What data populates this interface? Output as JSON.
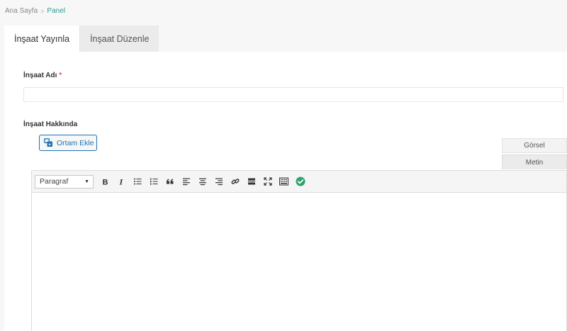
{
  "breadcrumb": {
    "home": "Ana Sayfa",
    "separator": ">",
    "current": "Panel"
  },
  "tabs": [
    {
      "label": "İnşaat Yayınla",
      "active": true
    },
    {
      "label": "İnşaat Düzenle",
      "active": false
    }
  ],
  "form": {
    "name_label": "İnşaat Adı",
    "required_mark": "*",
    "name_value": "",
    "about_label": "İnşaat Hakkında",
    "media_button": "Ortam Ekle"
  },
  "editor": {
    "mode_visual": "Görsel",
    "mode_text": "Metin",
    "format_select": "Paragraf",
    "toolbar_icons": [
      "bold-icon",
      "italic-icon",
      "bullet-list-icon",
      "numbered-list-icon",
      "blockquote-icon",
      "align-left-icon",
      "align-center-icon",
      "align-right-icon",
      "link-icon",
      "read-more-icon",
      "fullscreen-icon",
      "toolbar-toggle-icon",
      "check-circle-icon"
    ],
    "content": ""
  },
  "colors": {
    "accent": "#2a9d8f",
    "media_button": "#2271b1",
    "check": "#2ea36b",
    "required": "#d9534f"
  }
}
